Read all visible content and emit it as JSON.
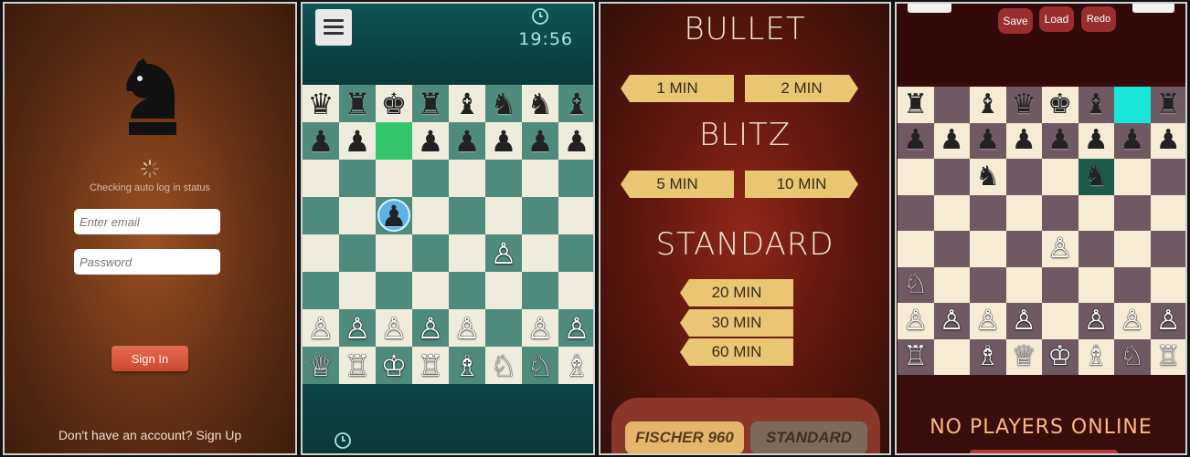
{
  "login": {
    "status_text": "Checking auto log in status",
    "email_placeholder": "Enter email",
    "password_placeholder": "Password",
    "sign_in_label": "Sign In",
    "signup_text": "Don't have an account? Sign Up",
    "logo_icon": "chess-knight-icon"
  },
  "game_green": {
    "menu_icon": "hamburger-menu-icon",
    "timer": "19:56",
    "clock_icon": "clock-icon",
    "board": [
      [
        "♛",
        "♜",
        "♚",
        "♜",
        "♝",
        "♞",
        "♞",
        "♝"
      ],
      [
        "♟",
        "♟",
        "",
        "♟",
        "♟",
        "♟",
        "♟",
        "♟"
      ],
      [
        "",
        "",
        "",
        "",
        "",
        "",
        "",
        ""
      ],
      [
        "",
        "",
        "♟",
        "",
        "",
        "",
        "",
        ""
      ],
      [
        "",
        "",
        "",
        "",
        "",
        "♙",
        "",
        ""
      ],
      [
        "",
        "",
        "",
        "",
        "",
        "",
        "",
        ""
      ],
      [
        "♙",
        "♙",
        "♙",
        "♙",
        "♙",
        "",
        "♙",
        "♙"
      ],
      [
        "♕",
        "♖",
        "♔",
        "♖",
        "♗",
        "♘",
        "♘",
        "♗"
      ]
    ],
    "highlight": {
      "row": 1,
      "col": 2,
      "color": "#32c56a"
    },
    "selected": {
      "row": 3,
      "col": 2,
      "color": "#5bb4e6"
    }
  },
  "time_select": {
    "bullet": {
      "title": "BULLET",
      "options": [
        "1 MIN",
        "2 MIN"
      ]
    },
    "blitz": {
      "title": "BLITZ",
      "options": [
        "5 MIN",
        "10 MIN"
      ]
    },
    "standard": {
      "title": "STANDARD",
      "options": [
        "20 MIN",
        "30 MIN",
        "60 MIN"
      ]
    },
    "modes": [
      "FISCHER 960",
      "STANDARD"
    ]
  },
  "game_brown": {
    "buttons": [
      "Save",
      "Load",
      "Redo"
    ],
    "board": [
      [
        "♜",
        "",
        "♝",
        "♛",
        "♚",
        "♝",
        "",
        "♜"
      ],
      [
        "♟",
        "♟",
        "♟",
        "♟",
        "♟",
        "♟",
        "♟",
        "♟"
      ],
      [
        "",
        "",
        "♞",
        "",
        "",
        "♞",
        "",
        ""
      ],
      [
        "",
        "",
        "",
        "",
        "",
        "",
        "",
        ""
      ],
      [
        "",
        "",
        "",
        "",
        "♙",
        "",
        "",
        ""
      ],
      [
        "♘",
        "",
        "",
        "",
        "",
        "",
        "",
        ""
      ],
      [
        "♙",
        "♙",
        "♙",
        "♙",
        "",
        "♙",
        "♙",
        "♙"
      ],
      [
        "♖",
        "",
        "♗",
        "♕",
        "♔",
        "♗",
        "♘",
        "♖"
      ]
    ],
    "highlight": {
      "row": 0,
      "col": 6,
      "color": "#19e6d6"
    },
    "dark_highlight": {
      "row": 2,
      "col": 5,
      "color": "#1e5a4a"
    },
    "status": "NO PLAYERS ONLINE"
  }
}
